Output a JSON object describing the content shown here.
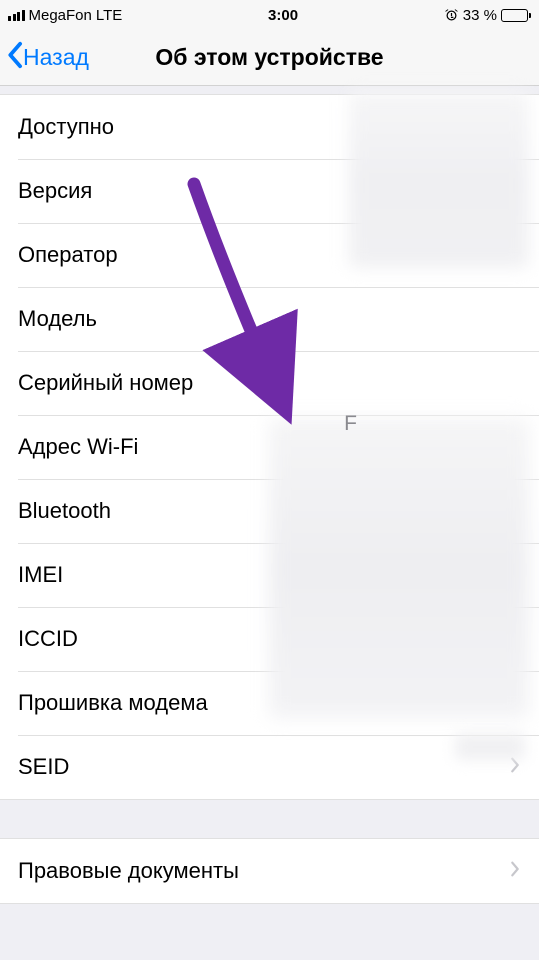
{
  "status": {
    "carrier": "MegaFon",
    "network": "LTE",
    "time": "3:00",
    "battery_percent": "33 %",
    "battery_level": 33
  },
  "nav": {
    "back": "Назад",
    "title": "Об этом устройстве"
  },
  "rows": {
    "available": "Доступно",
    "version": "Версия",
    "carrier": "Оператор",
    "model": "Модель",
    "serial": "Серийный номер",
    "serial_prefix": "F",
    "wifi": "Адрес Wi-Fi",
    "bluetooth": "Bluetooth",
    "imei": "IMEI",
    "iccid": "ICCID",
    "modem": "Прошивка модема",
    "seid": "SEID",
    "legal": "Правовые документы"
  }
}
